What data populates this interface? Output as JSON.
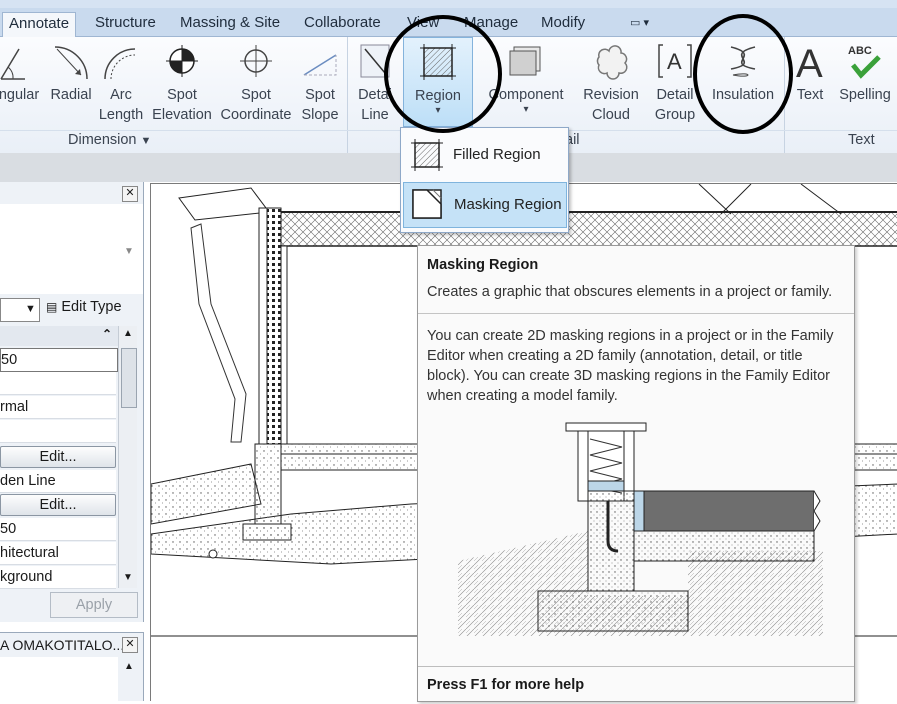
{
  "tabs": [
    {
      "label": "Annotate",
      "active": true
    },
    {
      "label": "Structure"
    },
    {
      "label": "Massing & Site"
    },
    {
      "label": "Collaborate"
    },
    {
      "label": "View"
    },
    {
      "label": "Manage"
    },
    {
      "label": "Modify"
    }
  ],
  "ribbon": {
    "buttons": [
      {
        "id": "angular",
        "l1": "ngular",
        "l2": ""
      },
      {
        "id": "radial",
        "l1": "Radial",
        "l2": ""
      },
      {
        "id": "arc",
        "l1": "Arc",
        "l2": "Length"
      },
      {
        "id": "spot-elev",
        "l1": "Spot",
        "l2": "Elevation"
      },
      {
        "id": "spot-coord",
        "l1": "Spot",
        "l2": "Coordinate"
      },
      {
        "id": "spot-slope",
        "l1": "Spot",
        "l2": "Slope"
      },
      {
        "id": "detail-line",
        "l1": "Detai",
        "l2": "Line"
      },
      {
        "id": "region",
        "l1": "Region",
        "l2": ""
      },
      {
        "id": "component",
        "l1": "Component",
        "l2": ""
      },
      {
        "id": "revision-cloud",
        "l1": "Revision",
        "l2": "Cloud"
      },
      {
        "id": "detail-group",
        "l1": "Detail",
        "l2": "Group"
      },
      {
        "id": "insulation",
        "l1": "Insulation",
        "l2": ""
      },
      {
        "id": "text",
        "l1": "Text",
        "l2": ""
      },
      {
        "id": "spelling",
        "l1": "Spelling",
        "l2": "",
        "glyph": "ABC"
      }
    ],
    "panels": {
      "dimension": "Dimension",
      "detail": "ail",
      "text": "Text"
    }
  },
  "dropdown": {
    "items": [
      {
        "label": "Filled Region",
        "highlighted": false
      },
      {
        "label": "Masking Region",
        "highlighted": true
      }
    ]
  },
  "tooltip": {
    "title": "Masking Region",
    "short": "Creates a graphic that obscures elements in a project or family.",
    "body": "You can create 2D masking regions in a project or in the Family Editor when creating a 2D family (annotation, detail, or title block). You can create 3D masking regions in the Family Editor when creating a model family.",
    "footer": "Press F1 for more help"
  },
  "properties": {
    "edit_type": "Edit Type",
    "rows": [
      "50",
      "",
      "rmal",
      "",
      "Edit...",
      "den Line",
      "Edit...",
      "50",
      "hitectural",
      "kground"
    ],
    "apply": "Apply",
    "browser_title": "A OMAKOTITALO..."
  },
  "colors": {
    "accent": "#c5e2f7",
    "tab_bg": "#c9daee"
  }
}
